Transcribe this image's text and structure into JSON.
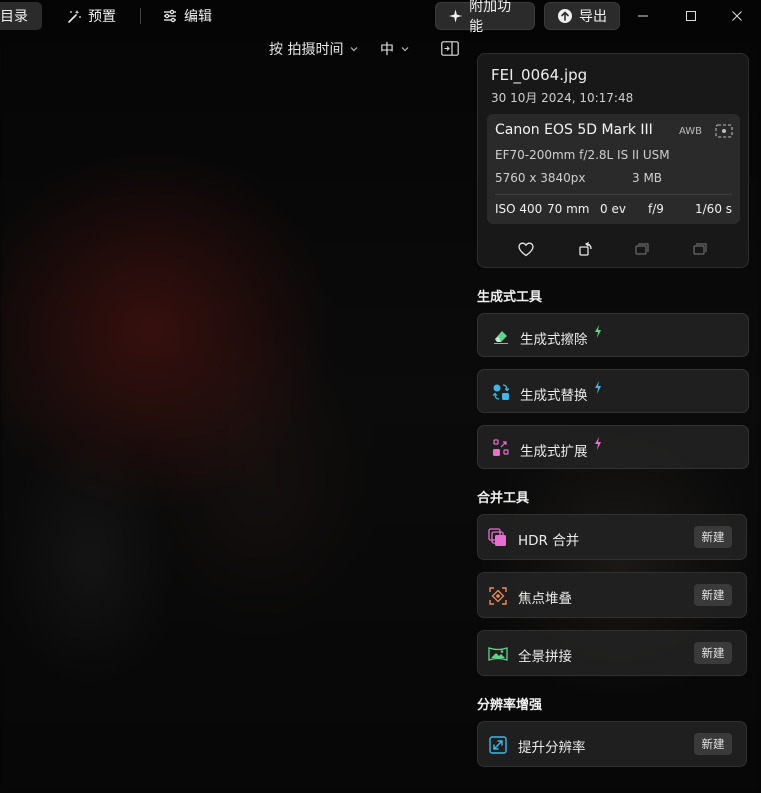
{
  "toolbar": {
    "catalog_label": "目录",
    "presets_label": "预置",
    "edit_label": "编辑",
    "addons_label": "附加功能",
    "export_label": "导出"
  },
  "window_controls": {
    "minimize": "—",
    "maximize": "☐",
    "close": "✕"
  },
  "sortbar": {
    "sort_label": "按 拍摄时间",
    "size_label": "中"
  },
  "info": {
    "file_name": "FEI_0064.jpg",
    "date": "30 10月 2024, 10:17:48",
    "camera": "Canon EOS 5D Mark III",
    "awb": "AWB",
    "lens": "EF70-200mm f/2.8L IS II USM",
    "dimensions": "5760 x 3840px",
    "file_size": "3 MB",
    "iso": "ISO 400",
    "focal": "70 mm",
    "ev": "0 ev",
    "aperture": "f/9",
    "shutter": "1/60 s"
  },
  "generative": {
    "heading": "生成式工具",
    "tools": [
      {
        "label": "生成式擦除",
        "icon": "eraser-icon",
        "bolt_color": "#5fd38a"
      },
      {
        "label": "生成式替换",
        "icon": "replace-icon",
        "bolt_color": "#3fb7e8"
      },
      {
        "label": "生成式扩展",
        "icon": "expand-icon",
        "bolt_color": "#e86fd0"
      }
    ]
  },
  "merge": {
    "heading": "合并工具",
    "tools": [
      {
        "label": "HDR 合并",
        "icon": "hdr-merge-icon",
        "button": "新建"
      },
      {
        "label": "焦点堆叠",
        "icon": "focus-stack-icon",
        "button": "新建"
      },
      {
        "label": "全景拼接",
        "icon": "panorama-icon",
        "button": "新建"
      }
    ]
  },
  "resolution": {
    "heading": "分辨率增强",
    "tools": [
      {
        "label": "提升分辨率",
        "icon": "upscale-icon",
        "button": "新建"
      }
    ]
  },
  "colors": {
    "accent_green": "#5fd38a",
    "accent_blue": "#3fb7e8",
    "accent_pink": "#e86fd0",
    "accent_orange": "#f08a5d"
  }
}
